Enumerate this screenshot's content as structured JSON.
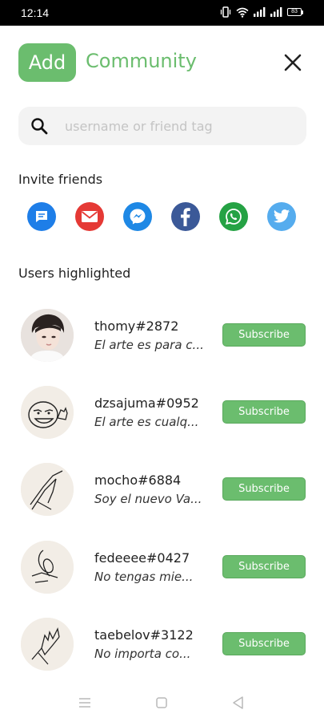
{
  "status_bar": {
    "time": "12:14",
    "battery": "83"
  },
  "header": {
    "badge_label": "Add",
    "title": "Community",
    "brand_color": "#6bbd6e"
  },
  "search": {
    "placeholder": "username or friend tag",
    "value": ""
  },
  "invite": {
    "title": "Invite friends",
    "channels": [
      {
        "name": "messages",
        "icon": "message-icon",
        "color": "#1e7ee8"
      },
      {
        "name": "email",
        "icon": "mail-icon",
        "color": "#e53935"
      },
      {
        "name": "messenger",
        "icon": "messenger-icon",
        "color": "#1e88e5"
      },
      {
        "name": "facebook",
        "icon": "facebook-icon",
        "color": "#3b5998"
      },
      {
        "name": "whatsapp",
        "icon": "whatsapp-icon",
        "color": "#25a244"
      },
      {
        "name": "twitter",
        "icon": "twitter-icon",
        "color": "#55acee"
      }
    ]
  },
  "users": {
    "title": "Users highlighted",
    "subscribe_label": "Subscribe",
    "items": [
      {
        "username": "thomy#2872",
        "bio": "El arte es para c..."
      },
      {
        "username": "dzsajuma#0952",
        "bio": "El arte es cualq..."
      },
      {
        "username": "mocho#6884",
        "bio": "Soy el nuevo Va..."
      },
      {
        "username": "fedeeee#0427",
        "bio": "No tengas mie..."
      },
      {
        "username": "taebelov#3122",
        "bio": "No importa co..."
      }
    ]
  }
}
